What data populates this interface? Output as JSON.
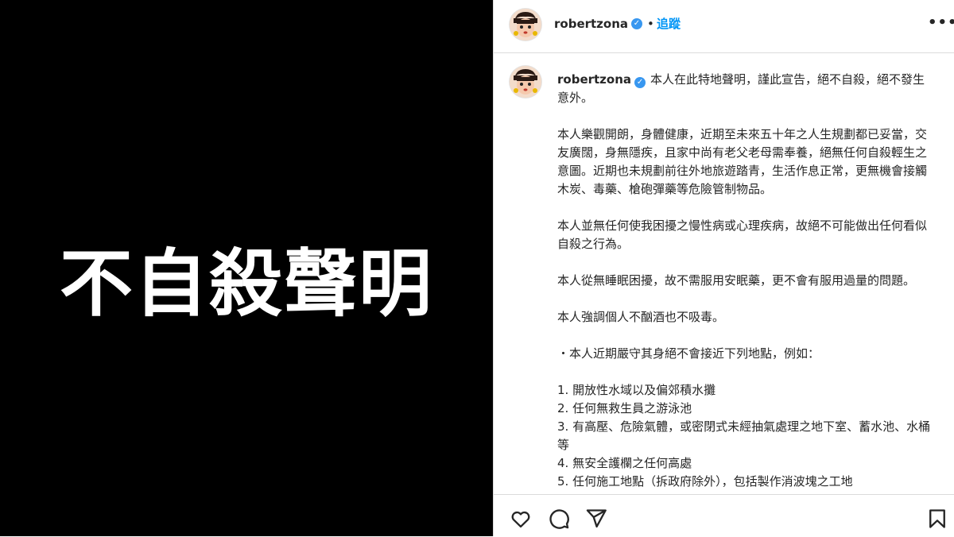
{
  "media": {
    "headline": "不自殺聲明",
    "background_color": "#000000",
    "text_color": "#ffffff"
  },
  "post_header": {
    "username": "robertzona",
    "verified_icon": "verified-badge-icon",
    "separator": "•",
    "follow_label": "追蹤",
    "more_icon": "more-options-icon",
    "more_glyph": "•••"
  },
  "caption": {
    "username": "robertzona",
    "text": "本人在此特地聲明，謹此宣告，絕不自殺，絕不發生意外。\n\n本人樂觀開朗，身體健康，近期至未來五十年之人生規劃都已妥當，交友廣闊，身無隱疾，且家中尚有老父老母需奉養，絕無任何自殺輕生之意圖。近期也未規劃前往外地旅遊踏青，生活作息正常，更無機會接觸木炭、毒藥、槍砲彈藥等危險管制物品。\n\n本人並無任何使我困擾之慢性病或心理疾病，故絕不可能做出任何看似自殺之行為。\n\n本人從無睡眠困擾，故不需服用安眠藥，更不會有服用過量的問題。\n\n本人強調個人不酗酒也不吸毒。\n\n・本人近期嚴守其身絕不會接近下列地點，例如：\n\n1. 開放性水域以及偏郊積水攤\n2. 任何無救生員之游泳池\n3. 有高壓、危險氣體，或密閉式未經抽氣處理之地下室、蓄水池、水桶等\n4. 無安全護欄之任何高處\n5. 任何施工地點（拆政府除外），包括製作消波塊之工地"
  },
  "actions": {
    "like_icon": "heart-icon",
    "comment_icon": "comment-icon",
    "share_icon": "paper-plane-share-icon",
    "save_icon": "bookmark-icon"
  },
  "colors": {
    "link_blue": "#0095f6",
    "verified_blue": "#3897f0",
    "text": "#262626",
    "divider": "#dbdbdb"
  }
}
